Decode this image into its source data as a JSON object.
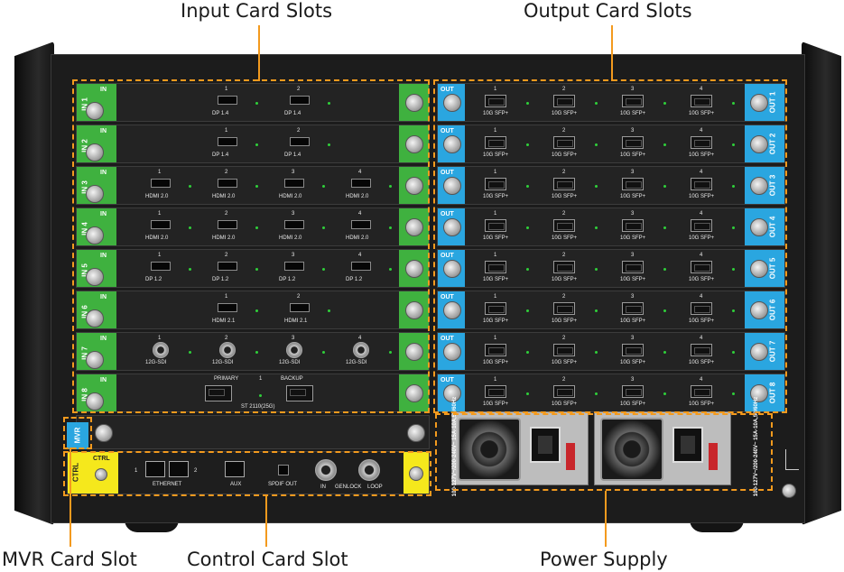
{
  "callouts": {
    "input": "Input Card Slots",
    "output": "Output Card Slots",
    "mvr": "MVR Card Slot",
    "control": "Control Card Slot",
    "power": "Power Supply"
  },
  "input_cards": [
    {
      "tab_label": "IN",
      "side_label": "IN 1",
      "ports": [
        "DP 1.4",
        "DP 1.4"
      ],
      "numbers": [
        "1",
        "2"
      ]
    },
    {
      "tab_label": "IN",
      "side_label": "IN 2",
      "ports": [
        "DP 1.4",
        "DP 1.4"
      ],
      "numbers": [
        "1",
        "2"
      ]
    },
    {
      "tab_label": "IN",
      "side_label": "IN 3",
      "ports": [
        "HDMI 2.0",
        "HDMI 2.0",
        "HDMI 2.0",
        "HDMI 2.0"
      ],
      "numbers": [
        "1",
        "2",
        "3",
        "4"
      ]
    },
    {
      "tab_label": "IN",
      "side_label": "IN 4",
      "ports": [
        "HDMI 2.0",
        "HDMI 2.0",
        "HDMI 2.0",
        "HDMI 2.0"
      ],
      "numbers": [
        "1",
        "2",
        "3",
        "4"
      ]
    },
    {
      "tab_label": "IN",
      "side_label": "IN 5",
      "ports": [
        "DP 1.2",
        "DP 1.2",
        "DP 1.2",
        "DP 1.2"
      ],
      "numbers": [
        "1",
        "2",
        "3",
        "4"
      ]
    },
    {
      "tab_label": "IN",
      "side_label": "IN 6",
      "ports": [
        "HDMI 2.1",
        "HDMI 2.1"
      ],
      "numbers": [
        "1",
        "2"
      ]
    },
    {
      "tab_label": "IN",
      "side_label": "IN 7",
      "ports": [
        "12G-SDI",
        "12G-SDI",
        "12G-SDI",
        "12G-SDI"
      ],
      "numbers": [
        "1",
        "2",
        "3",
        "4"
      ]
    },
    {
      "tab_label": "IN",
      "side_label": "IN 8",
      "primary": "PRIMARY",
      "backup": "BACKUP",
      "number": "1",
      "st": "ST 2110(25G)"
    }
  ],
  "output_cards": [
    {
      "tab_label": "OUT",
      "side_label": "OUT 1",
      "port_label": "10G SFP+",
      "numbers": [
        "1",
        "2",
        "3",
        "4"
      ]
    },
    {
      "tab_label": "OUT",
      "side_label": "OUT 2",
      "port_label": "10G SFP+",
      "numbers": [
        "1",
        "2",
        "3",
        "4"
      ]
    },
    {
      "tab_label": "OUT",
      "side_label": "OUT 3",
      "port_label": "10G SFP+",
      "numbers": [
        "1",
        "2",
        "3",
        "4"
      ]
    },
    {
      "tab_label": "OUT",
      "side_label": "OUT 4",
      "port_label": "10G SFP+",
      "numbers": [
        "1",
        "2",
        "3",
        "4"
      ]
    },
    {
      "tab_label": "OUT",
      "side_label": "OUT 5",
      "port_label": "10G SFP+",
      "numbers": [
        "1",
        "2",
        "3",
        "4"
      ]
    },
    {
      "tab_label": "OUT",
      "side_label": "OUT 6",
      "port_label": "10G SFP+",
      "numbers": [
        "1",
        "2",
        "3",
        "4"
      ]
    },
    {
      "tab_label": "OUT",
      "side_label": "OUT 7",
      "port_label": "10G SFP+",
      "numbers": [
        "1",
        "2",
        "3",
        "4"
      ]
    },
    {
      "tab_label": "OUT",
      "side_label": "OUT 8",
      "port_label": "10G SFP+",
      "numbers": [
        "1",
        "2",
        "3",
        "4"
      ]
    }
  ],
  "mvr": {
    "label": "MVR"
  },
  "control": {
    "label": "CTRL",
    "ethernet": "ETHERNET",
    "eth_1": "1",
    "eth_2": "2",
    "aux": "AUX",
    "spdif": "SPDIF OUT",
    "genlock_in": "IN",
    "genlock": "GENLOCK",
    "genlock_loop": "LOOP"
  },
  "psu": {
    "rating": "100-127V~/200-240V~ 15A-10A,50/60Hz"
  },
  "colors": {
    "accent": "#f39a1e",
    "input_tab": "#3fb13f",
    "output_tab": "#2aa6e0",
    "ctrl_tab": "#f5e81c"
  }
}
